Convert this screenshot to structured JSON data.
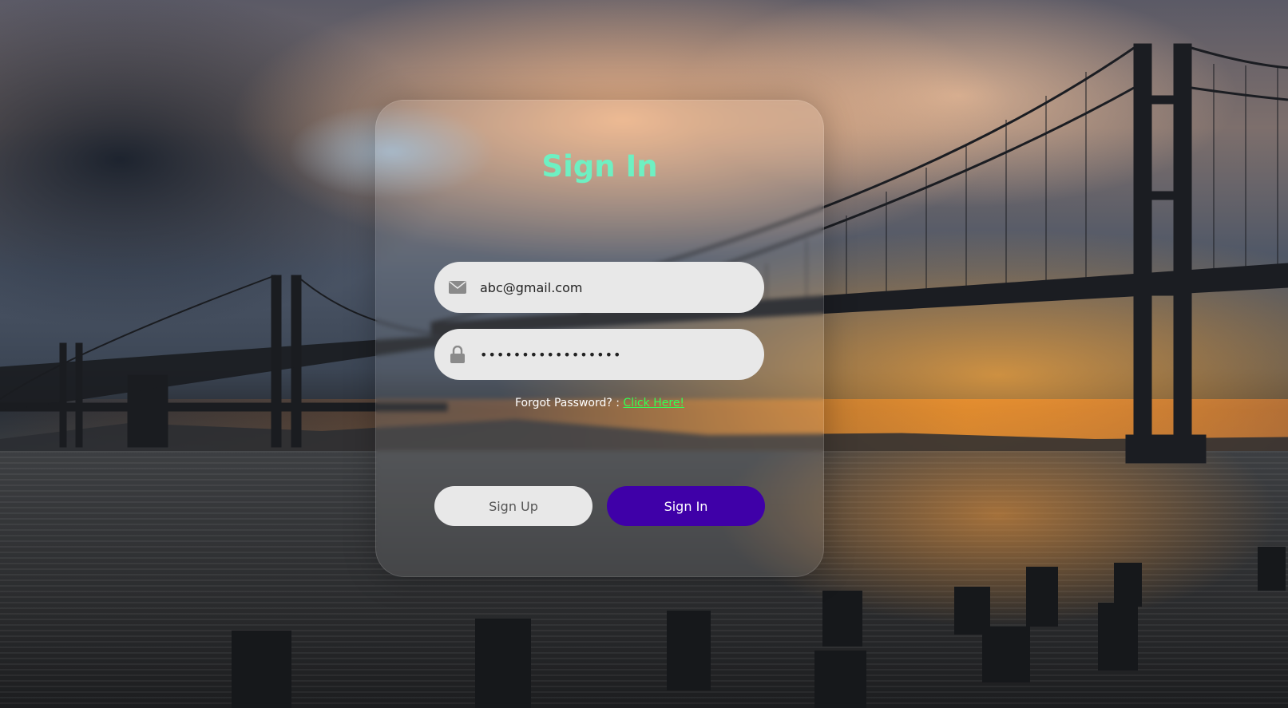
{
  "page": {
    "title": "Sign In"
  },
  "form": {
    "email_value": "abc@gmail.com",
    "email_icon": "envelope-icon",
    "password_value": "•••••••••••••••••",
    "password_icon": "lock-icon",
    "forgot_text": "Forgot Password? : ",
    "forgot_link": "Click Here!",
    "signup_label": "Sign Up",
    "signin_label": "Sign In"
  },
  "colors": {
    "title": "#6ef0c2",
    "signin_button": "#3f00a8",
    "field_background": "#e8e8e8",
    "link": "#33ff55"
  }
}
